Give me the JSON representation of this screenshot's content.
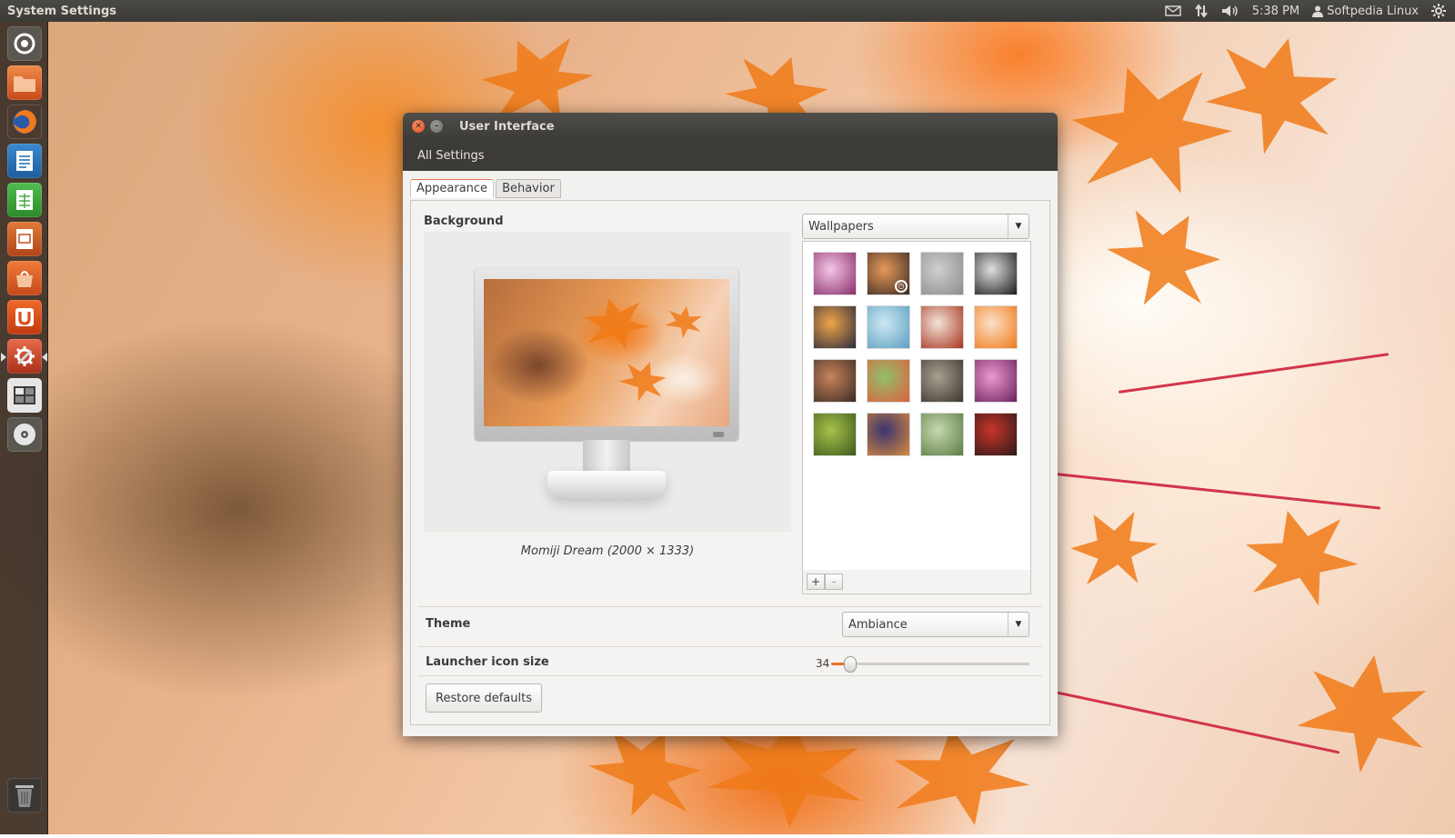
{
  "top_panel": {
    "app_title": "System Settings",
    "time": "5:38 PM",
    "user": "Softpedia Linux"
  },
  "launcher": {
    "items": [
      {
        "icon": "dash-home-icon",
        "color": "#5a5650"
      },
      {
        "icon": "files-folder-icon",
        "color": "#e0692f"
      },
      {
        "icon": "firefox-icon",
        "color": "#e8661c"
      },
      {
        "icon": "libreoffice-writer-icon",
        "color": "#2a74b8"
      },
      {
        "icon": "libreoffice-calc-icon",
        "color": "#3ca63c"
      },
      {
        "icon": "libreoffice-impress-icon",
        "color": "#c85a2a"
      },
      {
        "icon": "software-center-icon",
        "color": "#d85a28"
      },
      {
        "icon": "ubuntu-one-icon",
        "color": "#d8501e"
      },
      {
        "icon": "system-settings-icon",
        "color": "#c8452a"
      },
      {
        "icon": "workspace-switcher-icon",
        "color": "#3c3c3c"
      },
      {
        "icon": "optical-drive-icon",
        "color": "#e6e6e6"
      },
      {
        "icon": "trash-icon",
        "color": "#6a6a6a"
      }
    ]
  },
  "window": {
    "title": "User Interface",
    "all_settings": "All Settings",
    "tabs": [
      {
        "label": "Appearance",
        "active": true
      },
      {
        "label": "Behavior",
        "active": false
      }
    ],
    "background": {
      "label": "Background",
      "caption": "Momiji Dream (2000 × 1333)",
      "source_select": "Wallpapers",
      "add_label": "+",
      "remove_label": "–"
    },
    "theme": {
      "label": "Theme",
      "value": "Ambiance"
    },
    "launcher_icon_size": {
      "label": "Launcher icon size",
      "value": "34",
      "fraction": 0.09
    },
    "restore_label": "Restore defaults"
  },
  "wallpapers": [
    {
      "name": "purple-glow",
      "colors": [
        "#f3c6e6",
        "#8a2d6b"
      ]
    },
    {
      "name": "desert-dusk",
      "colors": [
        "#e79a5a",
        "#3a2a24"
      ],
      "selected": true
    },
    {
      "name": "grey-fog",
      "colors": [
        "#cfcfcf",
        "#8c8c8c"
      ]
    },
    {
      "name": "bw-pattern",
      "colors": [
        "#e0e0e0",
        "#1a1a1a"
      ]
    },
    {
      "name": "sunset-plain",
      "colors": [
        "#f0a64a",
        "#2b2a3c"
      ]
    },
    {
      "name": "blue-ice",
      "colors": [
        "#cde8f2",
        "#5b9fc1"
      ]
    },
    {
      "name": "autumn-road",
      "colors": [
        "#f3e4d8",
        "#a8331f"
      ]
    },
    {
      "name": "maple-leaf",
      "colors": [
        "#fbe0c9",
        "#f07a18"
      ]
    },
    {
      "name": "hills-dusk",
      "colors": [
        "#c8835c",
        "#3a2c22"
      ]
    },
    {
      "name": "poppy-field",
      "colors": [
        "#8fc06a",
        "#e06040"
      ]
    },
    {
      "name": "pen-nib",
      "colors": [
        "#a9a090",
        "#3b352e"
      ]
    },
    {
      "name": "pink-bokeh",
      "colors": [
        "#ec9acd",
        "#6a1f5c"
      ]
    },
    {
      "name": "green-bokeh",
      "colors": [
        "#a8c24a",
        "#3d5a1c"
      ]
    },
    {
      "name": "night-fox",
      "colors": [
        "#3a3470",
        "#d88a3c"
      ]
    },
    {
      "name": "tall-grass",
      "colors": [
        "#c6d8b0",
        "#5d7c44"
      ]
    },
    {
      "name": "red-music",
      "colors": [
        "#c9342a",
        "#2a1a1a"
      ]
    }
  ]
}
